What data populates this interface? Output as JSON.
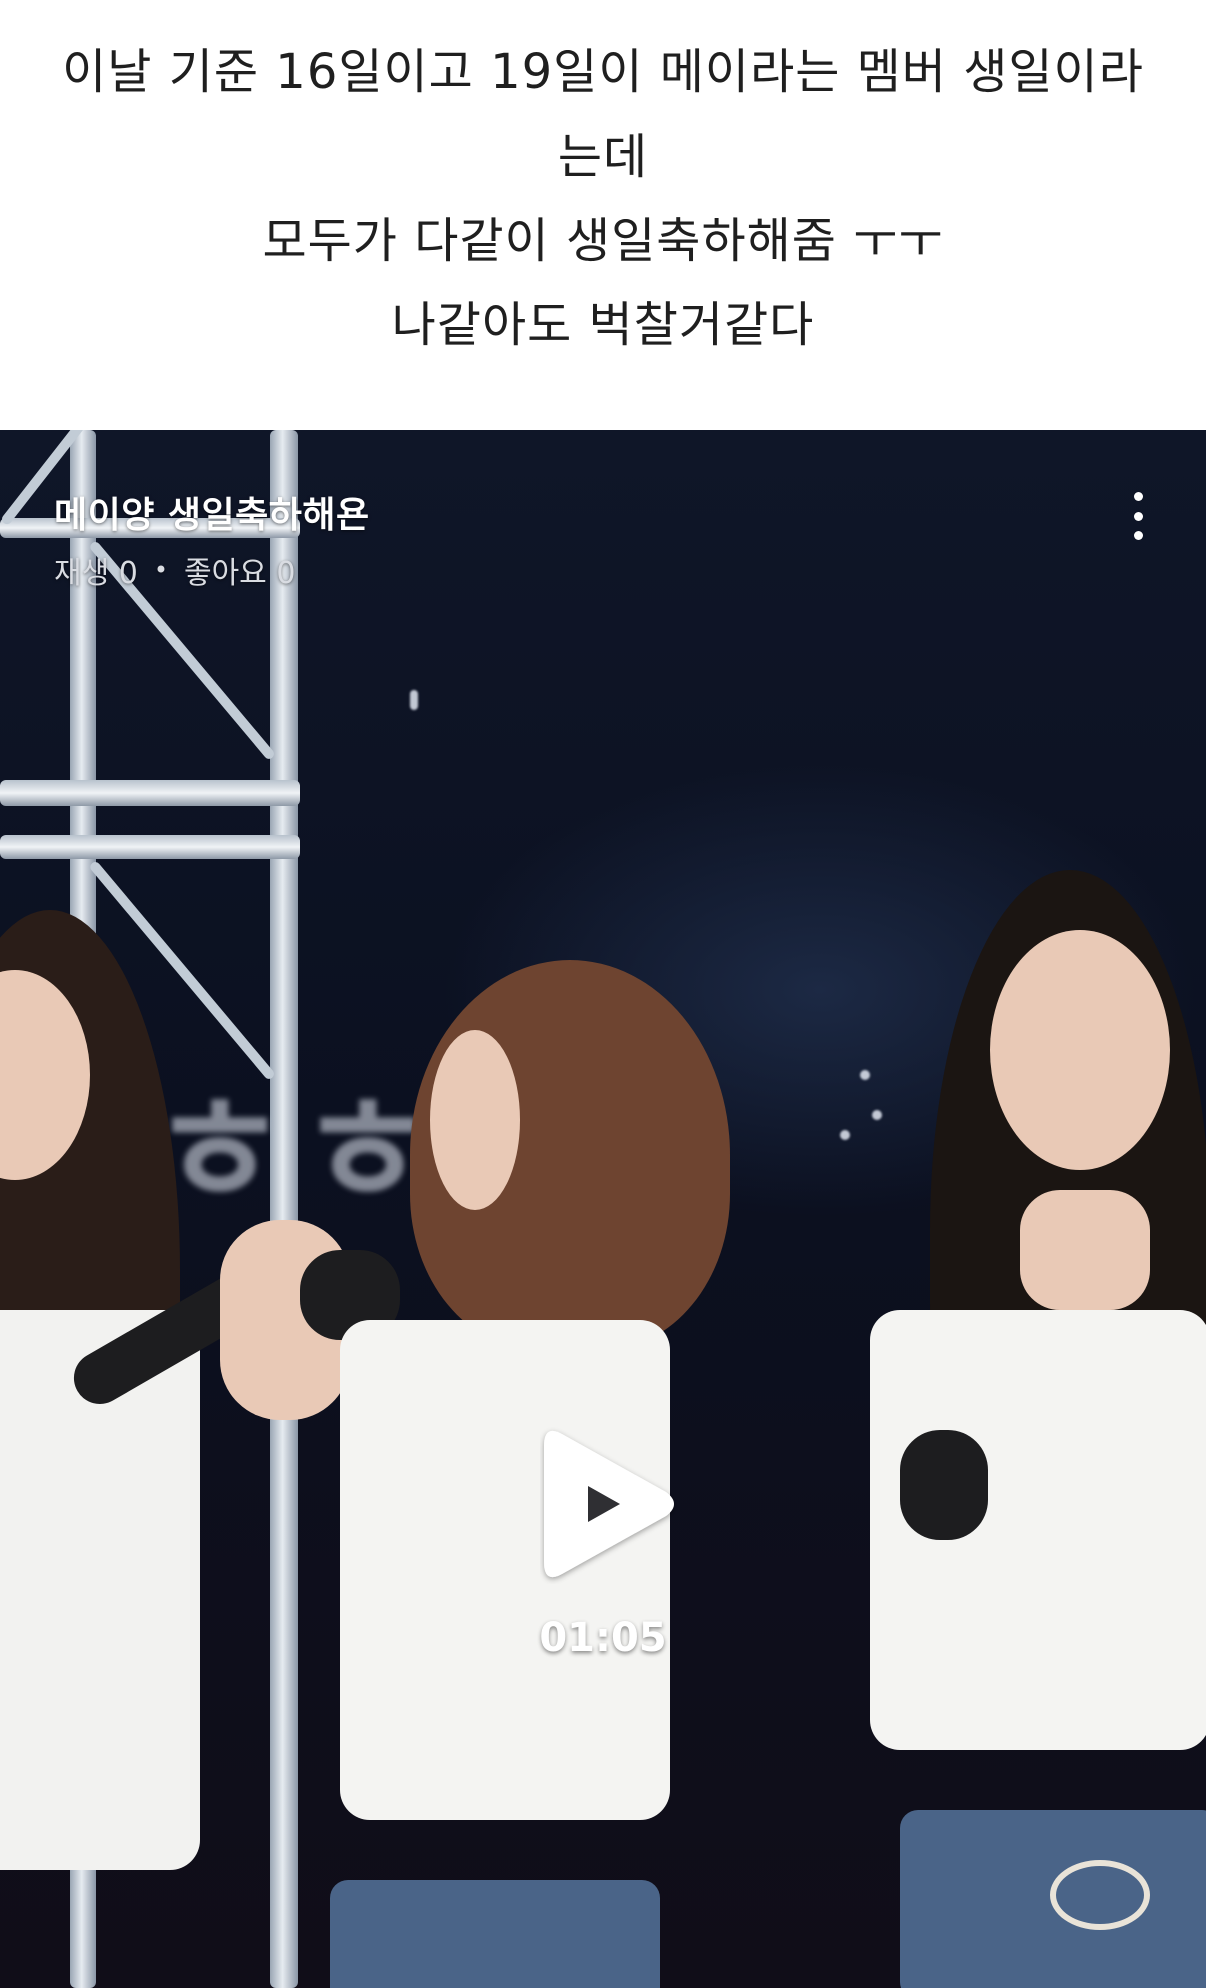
{
  "post": {
    "lines": [
      "이날 기준 16일이고 19일이 메이라는 멤버 생일이라",
      "는데",
      "모두가 다같이 생일축하해줌 ㅜㅜ",
      "나같아도 벅찰거같다"
    ]
  },
  "video": {
    "title": "메이양 생일축하해욘",
    "stats": {
      "plays_label": "재생 0",
      "separator": "•",
      "likes_label": "좋아요 0"
    },
    "duration": "01:05",
    "icons": {
      "more": "more-vertical-icon",
      "play": "play-icon"
    },
    "background_text": "ㅎㅎ"
  }
}
